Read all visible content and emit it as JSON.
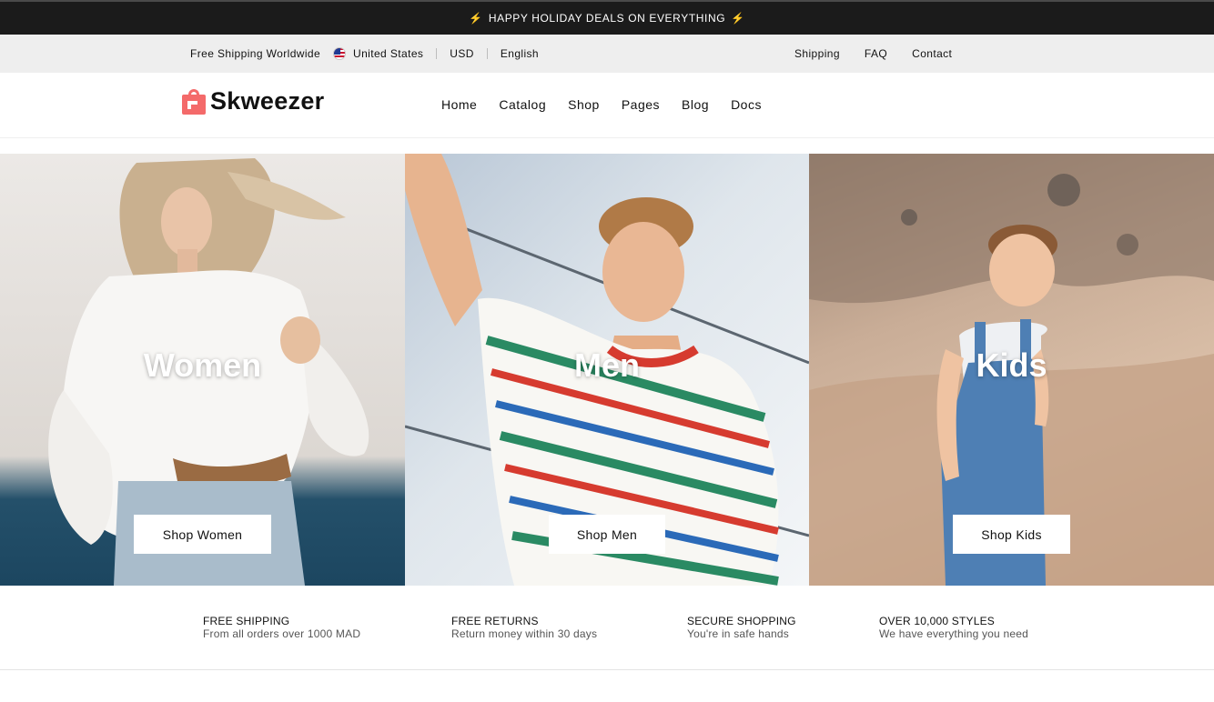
{
  "promo": {
    "text": "HAPPY HOLIDAY DEALS ON EVERYTHING",
    "icon": "lightning-icon",
    "bg": "#1b1b1b"
  },
  "utility": {
    "shipping_note": "Free Shipping Worldwide",
    "country": "United States",
    "currency": "USD",
    "language": "English",
    "links": [
      "Shipping",
      "FAQ",
      "Contact"
    ],
    "bg": "#eeeeee"
  },
  "header": {
    "brand": "Skweezer",
    "brand_color": "#f46a6a",
    "nav": [
      "Home",
      "Catalog",
      "Shop",
      "Pages",
      "Blog",
      "Docs"
    ]
  },
  "hero": {
    "panels": [
      {
        "title": "Women",
        "button": "Shop Women"
      },
      {
        "title": "Men",
        "button": "Shop Men"
      },
      {
        "title": "Kids",
        "button": "Shop Kids"
      }
    ]
  },
  "features": [
    {
      "title": "FREE SHIPPING",
      "subtitle": "From all orders over 1000 MAD"
    },
    {
      "title": "FREE RETURNS",
      "subtitle": "Return money within 30 days"
    },
    {
      "title": "SECURE SHOPPING",
      "subtitle": "You're in safe hands"
    },
    {
      "title": "OVER 10,000 STYLES",
      "subtitle": "We have everything you need"
    }
  ]
}
